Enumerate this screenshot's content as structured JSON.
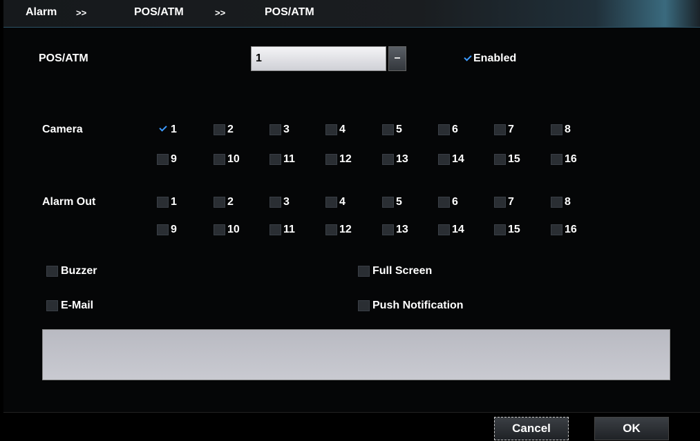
{
  "breadcrumb": {
    "item1": "Alarm",
    "sep1": ">>",
    "item2": "POS/ATM",
    "sep2": ">>",
    "item3": "POS/ATM"
  },
  "pos_atm": {
    "label": "POS/ATM",
    "selected": "1",
    "enabled_label": "Enabled",
    "enabled": true
  },
  "camera": {
    "label": "Camera",
    "items": [
      {
        "label": "1",
        "checked": true
      },
      {
        "label": "2",
        "checked": false
      },
      {
        "label": "3",
        "checked": false
      },
      {
        "label": "4",
        "checked": false
      },
      {
        "label": "5",
        "checked": false
      },
      {
        "label": "6",
        "checked": false
      },
      {
        "label": "7",
        "checked": false
      },
      {
        "label": "8",
        "checked": false
      },
      {
        "label": "9",
        "checked": false
      },
      {
        "label": "10",
        "checked": false
      },
      {
        "label": "11",
        "checked": false
      },
      {
        "label": "12",
        "checked": false
      },
      {
        "label": "13",
        "checked": false
      },
      {
        "label": "14",
        "checked": false
      },
      {
        "label": "15",
        "checked": false
      },
      {
        "label": "16",
        "checked": false
      }
    ]
  },
  "alarm_out": {
    "label": "Alarm Out",
    "items": [
      {
        "label": "1",
        "checked": false
      },
      {
        "label": "2",
        "checked": false
      },
      {
        "label": "3",
        "checked": false
      },
      {
        "label": "4",
        "checked": false
      },
      {
        "label": "5",
        "checked": false
      },
      {
        "label": "6",
        "checked": false
      },
      {
        "label": "7",
        "checked": false
      },
      {
        "label": "8",
        "checked": false
      },
      {
        "label": "9",
        "checked": false
      },
      {
        "label": "10",
        "checked": false
      },
      {
        "label": "11",
        "checked": false
      },
      {
        "label": "12",
        "checked": false
      },
      {
        "label": "13",
        "checked": false
      },
      {
        "label": "14",
        "checked": false
      },
      {
        "label": "15",
        "checked": false
      },
      {
        "label": "16",
        "checked": false
      }
    ]
  },
  "options": {
    "buzzer": {
      "label": "Buzzer",
      "checked": false
    },
    "full_screen": {
      "label": "Full Screen",
      "checked": false
    },
    "email": {
      "label": "E-Mail",
      "checked": false
    },
    "push_notification": {
      "label": "Push Notification",
      "checked": false
    }
  },
  "footer": {
    "cancel_label": "Cancel",
    "ok_label": "OK"
  },
  "colors": {
    "accent": "#3d9bff",
    "background": "#050607"
  }
}
